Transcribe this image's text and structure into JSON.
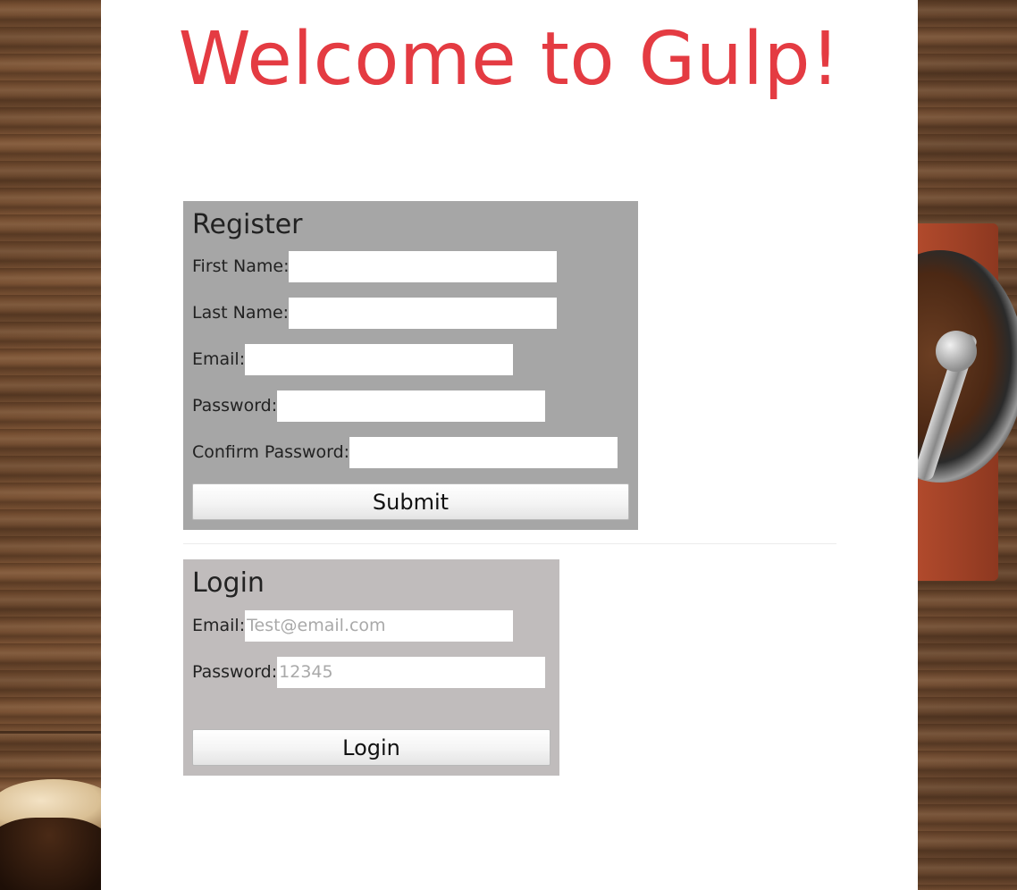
{
  "page": {
    "title": "Welcome to Gulp!"
  },
  "register": {
    "heading": "Register",
    "fields": [
      {
        "label": "First Name:",
        "value": "",
        "placeholder": ""
      },
      {
        "label": "Last Name:",
        "value": "",
        "placeholder": ""
      },
      {
        "label": "Email:",
        "value": "",
        "placeholder": ""
      },
      {
        "label": "Password:",
        "value": "",
        "placeholder": ""
      },
      {
        "label": "Confirm Password:",
        "value": "",
        "placeholder": ""
      }
    ],
    "submit_label": "Submit"
  },
  "login": {
    "heading": "Login",
    "fields": [
      {
        "label": "Email:",
        "value": "",
        "placeholder": "Test@email.com"
      },
      {
        "label": "Password:",
        "value": "",
        "placeholder": "12345"
      }
    ],
    "submit_label": "Login"
  },
  "colors": {
    "title": "#e43b42",
    "register_card": "#a6a6a6",
    "login_card": "#c0bcbc",
    "panel": "#ffffff"
  }
}
